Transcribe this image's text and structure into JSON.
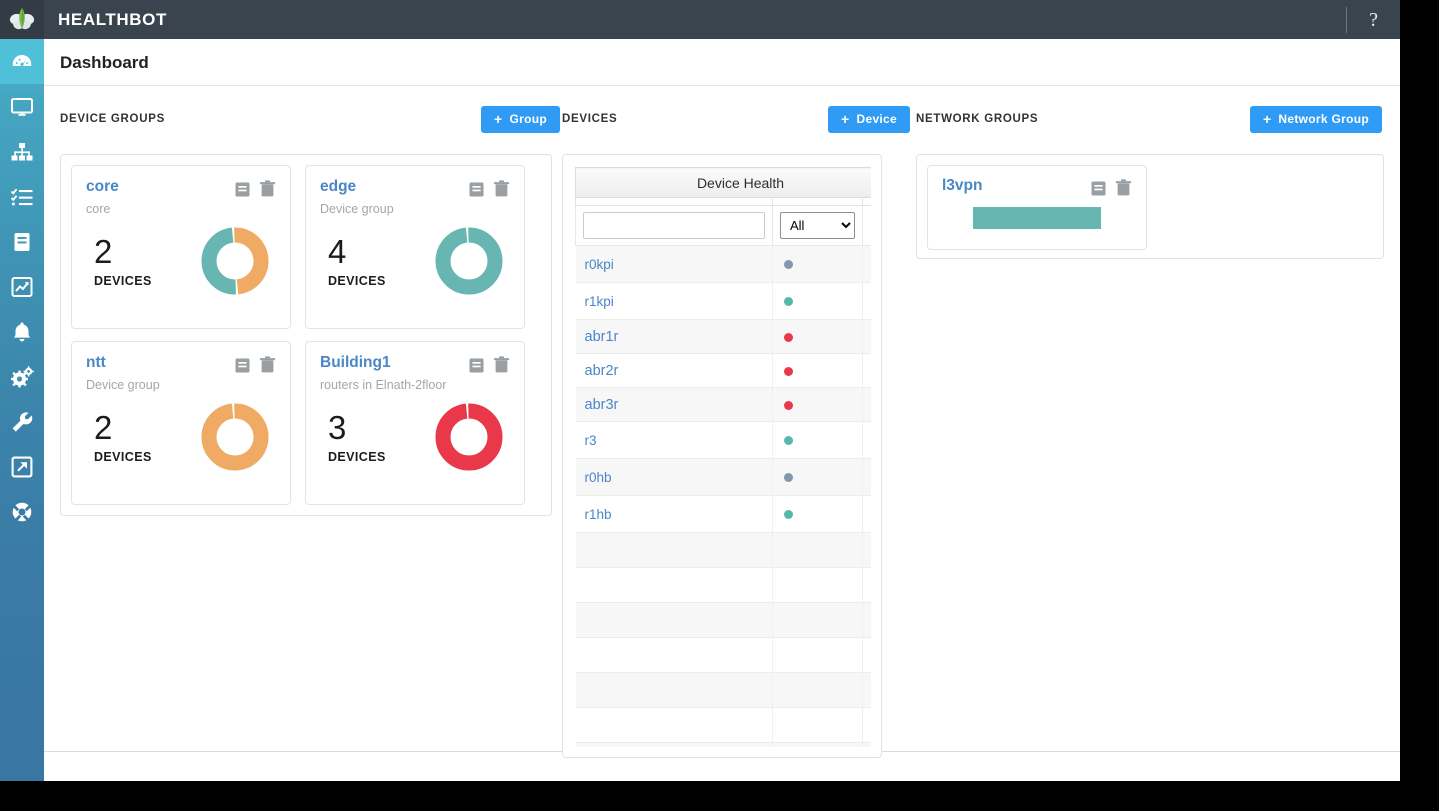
{
  "topbar": {
    "app_title": "HEALTHBOT",
    "help_label": "?",
    "logo_name": "juniper-logo"
  },
  "page": {
    "title": "Dashboard"
  },
  "sidebar": {
    "items": [
      {
        "name": "dashboard",
        "icon": "gauge-icon",
        "active": true
      },
      {
        "name": "devices",
        "icon": "monitor-icon",
        "active": false
      },
      {
        "name": "network-topology",
        "icon": "sitemap-icon",
        "active": false
      },
      {
        "name": "tasks",
        "icon": "checklist-icon",
        "active": false
      },
      {
        "name": "reports",
        "icon": "book-icon",
        "active": false
      },
      {
        "name": "analytics",
        "icon": "chart-line-icon",
        "active": false
      },
      {
        "name": "alarms",
        "icon": "bell-icon",
        "active": false
      },
      {
        "name": "settings",
        "icon": "gears-icon",
        "active": false
      },
      {
        "name": "tools",
        "icon": "wrench-icon",
        "active": false
      },
      {
        "name": "external-link",
        "icon": "external-link-icon",
        "active": false
      },
      {
        "name": "support",
        "icon": "lifebuoy-icon",
        "active": false
      }
    ]
  },
  "device_groups": {
    "label": "DEVICE GROUPS",
    "add_button": "Group",
    "add_plus": "+",
    "cards": [
      {
        "name": "core",
        "description": "core",
        "count": "2",
        "unit": "DEVICES",
        "donut": [
          {
            "color": "#efab63",
            "percent": 50
          },
          {
            "color": "#68b6b2",
            "percent": 50
          }
        ]
      },
      {
        "name": "edge",
        "description": "Device group",
        "count": "4",
        "unit": "DEVICES",
        "donut": [
          {
            "color": "#68b6b2",
            "percent": 100
          }
        ]
      },
      {
        "name": "ntt",
        "description": "Device group",
        "count": "2",
        "unit": "DEVICES",
        "donut": [
          {
            "color": "#efab63",
            "percent": 100
          }
        ]
      },
      {
        "name": "Building1",
        "description": "routers in Elnath-2floor",
        "count": "3",
        "unit": "DEVICES",
        "donut": [
          {
            "color": "#e8384a",
            "percent": 100
          }
        ]
      }
    ]
  },
  "devices": {
    "label": "DEVICES",
    "add_button": "Device",
    "add_plus": "+",
    "table": {
      "caption": "Device Health",
      "filter_value": "",
      "filter_placeholder": "",
      "select_value": "All",
      "select_options": [
        "All"
      ],
      "rows": [
        {
          "name": "r0kpi",
          "status_color": "#8297b0",
          "third": "·"
        },
        {
          "name": "r1kpi",
          "status_color": "#55b8ad",
          "third": "·"
        },
        {
          "name": "abr1r",
          "status_color": "#e8384a",
          "third": "·"
        },
        {
          "name": "abr2r",
          "status_color": "#e8384a",
          "third": "·"
        },
        {
          "name": "abr3r",
          "status_color": "#e8384a",
          "third": "·"
        },
        {
          "name": "r3",
          "status_color": "#55b8ad",
          "third": "·"
        },
        {
          "name": "r0hb",
          "status_color": "#8297b0",
          "third": "·"
        },
        {
          "name": "r1hb",
          "status_color": "#55b8ad",
          "third": "·"
        },
        {
          "name": "",
          "status_color": "",
          "third": ""
        },
        {
          "name": "",
          "status_color": "",
          "third": ""
        },
        {
          "name": "",
          "status_color": "",
          "third": ""
        },
        {
          "name": "",
          "status_color": "",
          "third": ""
        },
        {
          "name": "",
          "status_color": "",
          "third": ""
        },
        {
          "name": "",
          "status_color": "",
          "third": ""
        },
        {
          "name": "",
          "status_color": "",
          "third": ""
        }
      ]
    }
  },
  "network_groups": {
    "label": "NETWORK GROUPS",
    "add_button": "Network Group",
    "add_plus": "+",
    "cards": [
      {
        "name": "l3vpn",
        "bar_color": "#68b6b2"
      }
    ]
  },
  "colors": {
    "accent_blue": "#2f9bf5",
    "link_blue": "#4a86c8",
    "teal": "#68b6b2",
    "orange": "#efab63",
    "red": "#e8384a",
    "slate": "#8297b0",
    "topbar": "#3a444e"
  }
}
